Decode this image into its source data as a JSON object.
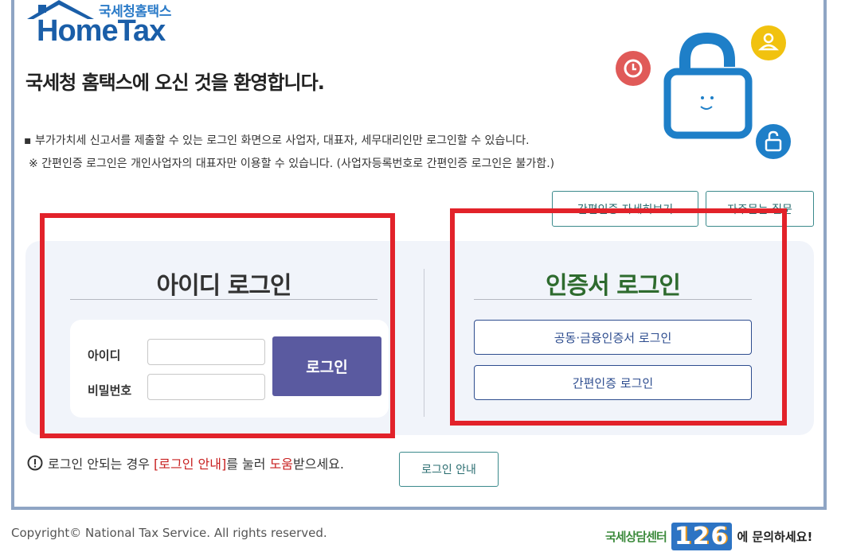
{
  "logo": {
    "sub": "국세청홈택스",
    "main": "HomeTax"
  },
  "welcome": "국세청 홈택스에 오신 것을 환영합니다.",
  "notices": {
    "line1": "▪ 부가가치세 신고서를 제출할 수 있는 로그인 화면으로 사업자, 대표자, 세무대리인만 로그인할 수 있습니다.",
    "line2": "※ 간편인증 로그인은 개인사업자의 대표자만 이용할 수 있습니다. (사업자등록번호로 간편인증 로그인은 불가함.)"
  },
  "top_buttons": {
    "simple_auth_detail": "간편인증 자세히보기",
    "faq": "자주묻는 질문"
  },
  "id_login": {
    "title": "아이디 로그인",
    "id_label": "아이디",
    "password_label": "비밀번호",
    "id_value": "",
    "password_value": "",
    "submit": "로그인"
  },
  "cert_login": {
    "title": "인증서 로그인",
    "joint_cert": "공동·금융인증서 로그인",
    "simple_cert": "간편인증 로그인"
  },
  "help": {
    "prefix": "로그인 안되는 경우 ",
    "link": "[로그인 안내]",
    "middle": "를 눌러 ",
    "highlight": "도움",
    "suffix": "받으세요.",
    "button": "로그인 안내"
  },
  "footer": {
    "copyright": "Copyright© National Tax Service. All rights reserved.",
    "center_label": "국세상담센터",
    "center_number": "126",
    "center_suffix": "에 문의하세요!"
  },
  "colors": {
    "accent_red": "#e2222a",
    "login_button": "#5a5aa0",
    "cert_title": "#2e6b2e",
    "frame_border": "#8fa5c4"
  }
}
